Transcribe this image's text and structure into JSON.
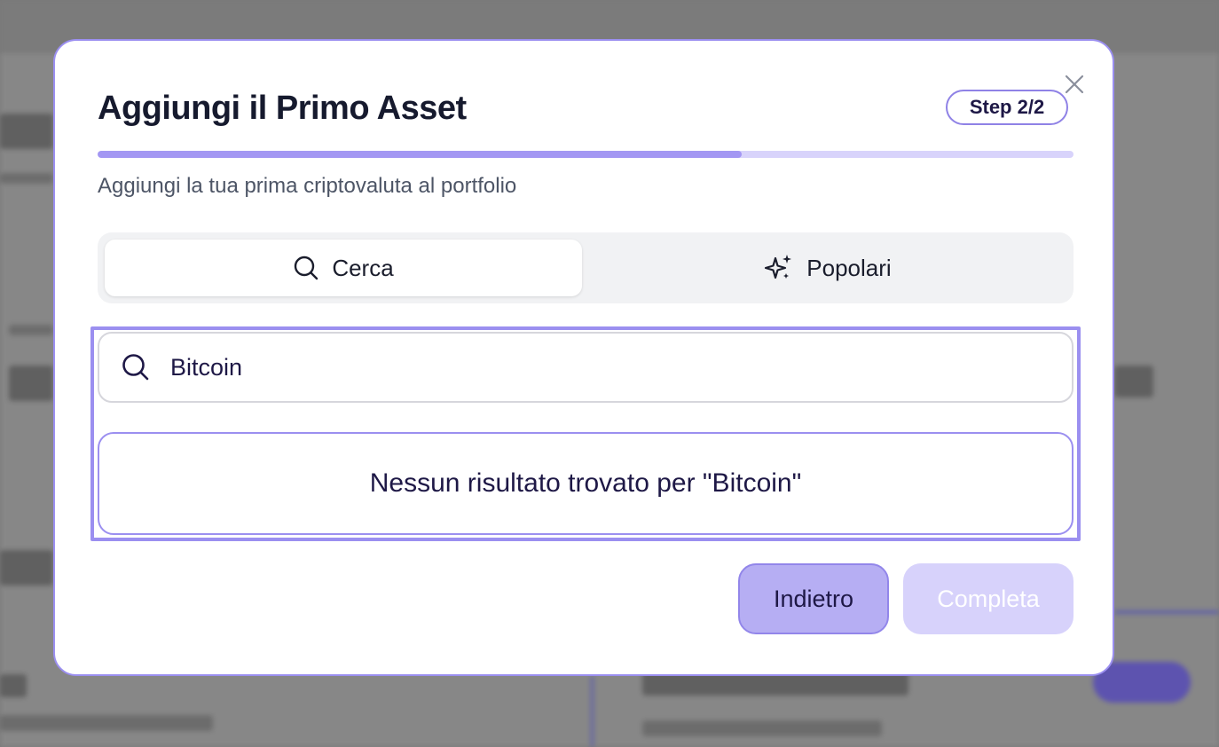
{
  "colors": {
    "accent": "#9b8ff0",
    "progress_fill": "#a397f3",
    "progress_track": "#d8d3fb",
    "back_button_bg": "#b6aef3",
    "complete_button_bg": "#d7d2fb",
    "title_text": "#161a2e"
  },
  "modal": {
    "title": "Aggiungi il Primo Asset",
    "step_badge": "Step 2/2",
    "progress_fraction": 0.66,
    "subtitle": "Aggiungi la tua prima criptovaluta al portfolio",
    "close_icon": "close-icon"
  },
  "tabs": [
    {
      "label": "Cerca",
      "icon": "search-icon",
      "active": true
    },
    {
      "label": "Popolari",
      "icon": "sparkles-icon",
      "active": false
    }
  ],
  "search": {
    "value": "Bitcoin",
    "icon": "search-icon"
  },
  "results": {
    "empty_message": "Nessun risultato trovato per \"Bitcoin\""
  },
  "footer": {
    "back_label": "Indietro",
    "complete_label": "Completa"
  }
}
